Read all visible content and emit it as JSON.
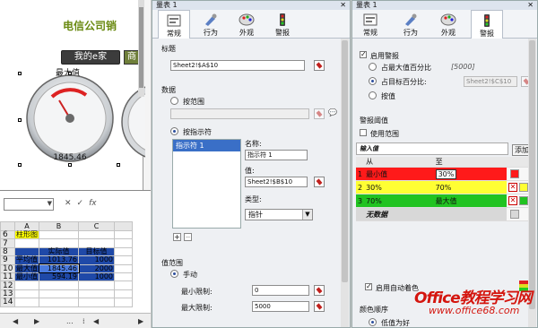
{
  "dashboard": {
    "title": "电信公司销",
    "button_mye": "我的e家",
    "button_next": "商",
    "gauge_label": "最大值",
    "gauge_value": "1845.46"
  },
  "sheet": {
    "fx": "fx",
    "col_headers": [
      "A",
      "B",
      "C"
    ],
    "rows": [
      {
        "n": "6",
        "a": "柱形图",
        "b": "",
        "c": ""
      },
      {
        "n": "7",
        "a": "",
        "b": "",
        "c": ""
      },
      {
        "n": "8",
        "a": "",
        "b": "实际值",
        "c": "目标值"
      },
      {
        "n": "9",
        "a": "平均值",
        "b": "1013.76",
        "c": "1000"
      },
      {
        "n": "10",
        "a": "最大值",
        "b": "1845.46",
        "c": "2000"
      },
      {
        "n": "11",
        "a": "最小值",
        "b": "594.19",
        "c": "1000"
      },
      {
        "n": "12",
        "a": "",
        "b": "",
        "c": ""
      },
      {
        "n": "13",
        "a": "",
        "b": "",
        "c": ""
      },
      {
        "n": "14",
        "a": "",
        "b": "",
        "c": ""
      }
    ]
  },
  "mid_panel": {
    "title": "量表 1",
    "tabs": [
      "常规",
      "行为",
      "外观",
      "警报"
    ],
    "title_section": "标题",
    "title_value": "Sheet2!$A$10",
    "data_section": "数据",
    "by_range": "按范围",
    "by_indicator": "按指示符",
    "indicator_item": "指示符 1",
    "name_label": "名称:",
    "name_value": "指示符 1",
    "value_label": "值:",
    "value_value": "Sheet2!$B$10",
    "type_label": "类型:",
    "type_value": "指针",
    "value_range": "值范围",
    "manual": "手动",
    "min_label": "最小限制:",
    "min_value": "0",
    "max_label": "最大限制:",
    "max_value": "5000"
  },
  "right_panel": {
    "title": "量表 1",
    "tabs": [
      "常规",
      "行为",
      "外观",
      "警报"
    ],
    "enable_alert": "启用警报",
    "pct_of_max": "占最大值百分比",
    "pct_of_max_hint": "[5000]",
    "pct_of_target": "占目标百分比:",
    "target_ref": "Sheet2!$C$10",
    "by_value": "按值",
    "alert_threshold": "警报阈值",
    "use_range": "使用范围",
    "new_rule": "输入值",
    "add": "添加",
    "col_from": "从",
    "col_to": "至",
    "rules": [
      {
        "idx": "1",
        "from": "最小值",
        "to": "30%",
        "color": "#ff1a1a"
      },
      {
        "idx": "2",
        "from": "30%",
        "to": "70%",
        "color": "#ffff33"
      },
      {
        "idx": "3",
        "from": "70%",
        "to": "最大值",
        "color": "#21c321"
      }
    ],
    "none_row": "无数据",
    "auto_color": "启用自动着色",
    "color_order": "颜色顺序",
    "low_is_good": "低值为好"
  },
  "watermark": {
    "line1": "Office教程学习网",
    "line2": "www.office68.com"
  }
}
